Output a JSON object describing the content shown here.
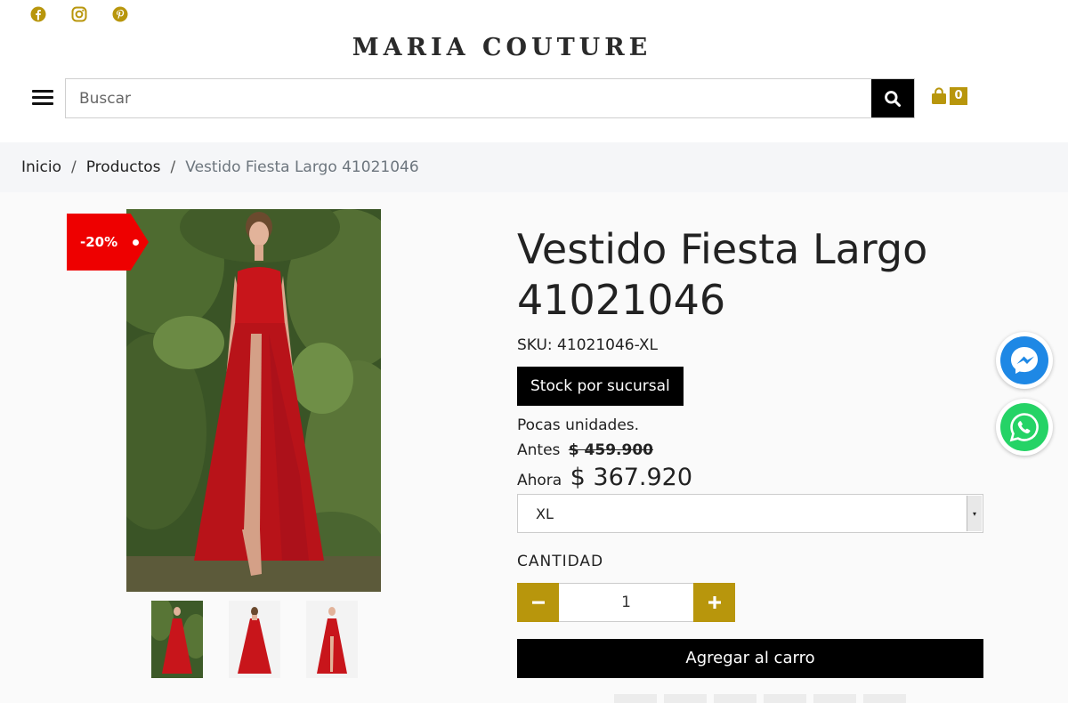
{
  "header": {
    "brand": "MARIA COUTURE",
    "social": [
      "facebook-icon",
      "instagram-icon",
      "pinterest-icon"
    ],
    "search_placeholder": "Buscar",
    "cart_count": "0"
  },
  "breadcrumb": {
    "home": "Inicio",
    "products": "Productos",
    "current": "Vestido Fiesta Largo 41021046",
    "separator": "/"
  },
  "product": {
    "discount": "-20%",
    "title": "Vestido Fiesta Largo 41021046",
    "sku": "SKU: 41021046-XL",
    "stock_button": "Stock por sucursal",
    "availability": "Pocas unidades.",
    "before_label": "Antes",
    "before_price": "$ 459.900",
    "now_label": "Ahora",
    "now_price": "$ 367.920",
    "size_selected": "XL",
    "quantity_label": "CANTIDAD",
    "quantity": "1",
    "add_to_cart": "Agregar al carro"
  },
  "colors": {
    "accent": "#b8960c",
    "badge": "#ee0000",
    "dress": "#c8151b",
    "foliage": "#3d5a28"
  }
}
